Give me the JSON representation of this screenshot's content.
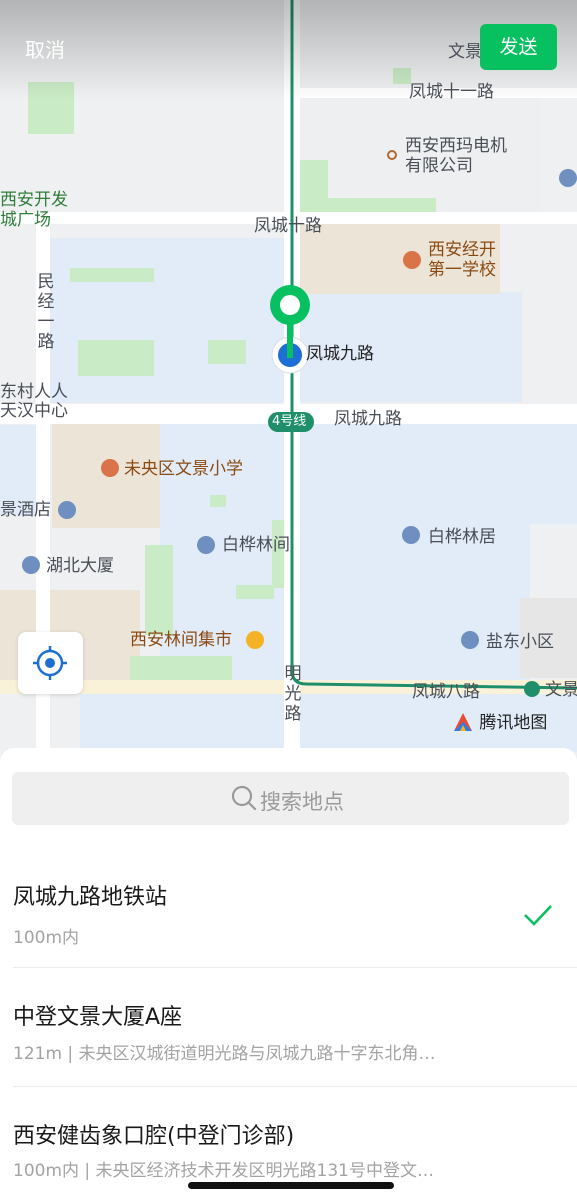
{
  "header": {
    "cancel_label": "取消",
    "send_label": "发送"
  },
  "map": {
    "roads": {
      "fengcheng11": "凤城十一路",
      "fengcheng10": "凤城十路",
      "fengcheng9": "凤城九路",
      "fengcheng8": "凤城八路",
      "mingguang": "明光路",
      "minjing1": "民经一路"
    },
    "metro_badge": "4号线",
    "labels": {
      "wenjing_top": "文景",
      "xian_xima_1": "西安西玛电机",
      "xian_xima_2": "有限公司",
      "kaifa_plaza_1": "西安开发",
      "kaifa_plaza_2": "城广场",
      "jingkai_school_1": "西安经开",
      "jingkai_school_2": "第一学校",
      "pin_label": "凤城九路",
      "dongcun_1": "东村人人",
      "dongcun_2": "天汉中心",
      "weiyang_school": "未央区文景小学",
      "jing_hotel": "景酒店",
      "baihua_jian": "白桦林间",
      "baihua_ju": "白桦林居",
      "hubei": "湖北大厦",
      "linjian_market": "西安林间集市",
      "yandong": "盐东小区",
      "wenjing_metro": "文景"
    },
    "logo": "腾讯地图"
  },
  "search": {
    "placeholder": "搜索地点"
  },
  "results": [
    {
      "name": "凤城九路地铁站",
      "detail": "100m内",
      "selected": true
    },
    {
      "name": "中登文景大厦A座",
      "detail": "121m | 未央区汉城街道明光路与凤城九路十字东北角…",
      "selected": false
    },
    {
      "name": "西安健齿象口腔(中登门诊部)",
      "detail": "100m内 | 未央区经济技术开发区明光路131号中登文…",
      "selected": false
    }
  ],
  "colors": {
    "accent": "#07c160",
    "metro_line": "#1f8f6b",
    "pin_blue": "#1d6fd6"
  }
}
